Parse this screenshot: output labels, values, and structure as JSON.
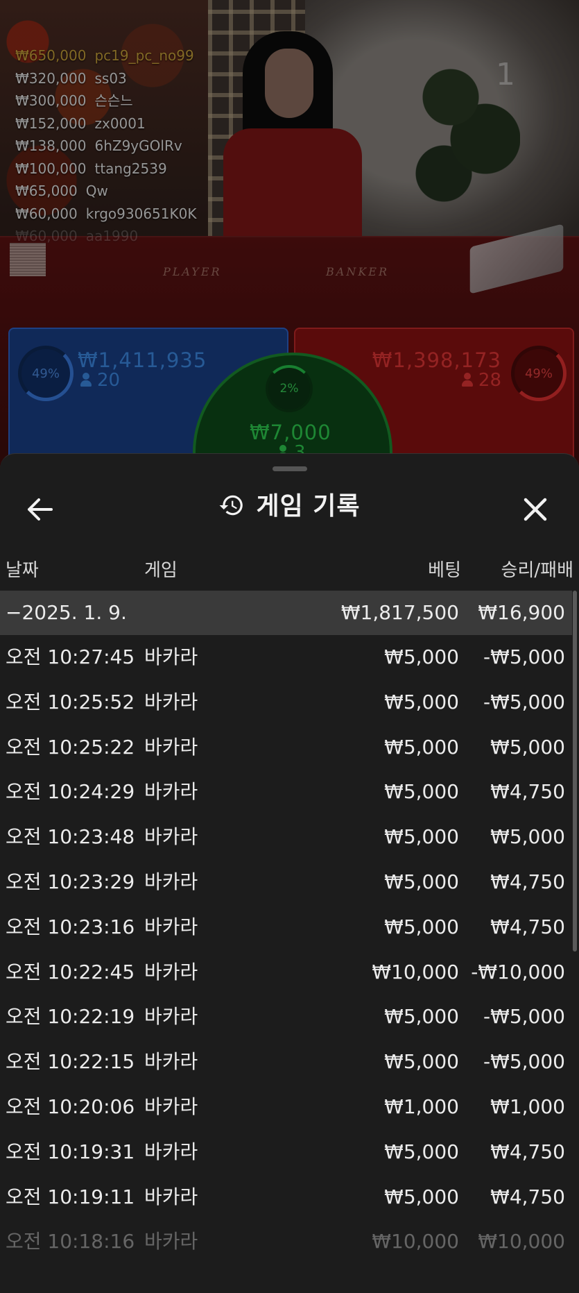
{
  "live": {
    "round_number": "1",
    "table_labels": {
      "player": "PLAYER",
      "banker": "BANKER"
    },
    "leaderboard": [
      {
        "amount": "₩650,000",
        "user": "pc19_pc_no99"
      },
      {
        "amount": "₩320,000",
        "user": "ss03"
      },
      {
        "amount": "₩300,000",
        "user": "슨슨느"
      },
      {
        "amount": "₩152,000",
        "user": "zx0001"
      },
      {
        "amount": "₩138,000",
        "user": "6hZ9yGOlRv"
      },
      {
        "amount": "₩100,000",
        "user": "ttang2539"
      },
      {
        "amount": "₩65,000",
        "user": "Qw"
      },
      {
        "amount": "₩60,000",
        "user": "krgo930651K0K"
      },
      {
        "amount": "₩60,000",
        "user": "aa1990"
      }
    ],
    "player": {
      "percent": "49%",
      "amount": "₩1,411,935",
      "count": "20"
    },
    "banker": {
      "percent": "49%",
      "amount": "₩1,398,173",
      "count": "28"
    },
    "tie": {
      "percent": "2%",
      "amount": "₩7,000",
      "count": "3"
    },
    "colors": {
      "player": "#3c8ae6",
      "banker": "#e33636",
      "tie": "#2ed050"
    }
  },
  "history": {
    "title": "게임 기록",
    "icons": {
      "back": "arrow-left-icon",
      "history": "history-icon",
      "close": "close-icon"
    },
    "columns": {
      "date": "날짜",
      "game": "게임",
      "bet": "베팅",
      "result": "승리/패배"
    },
    "date_group": {
      "label": "−2025. 1. 9.",
      "bet_total": "₩1,817,500",
      "result_total": "₩16,900"
    },
    "rows": [
      {
        "time": "오전 10:27:45",
        "game": "바카라",
        "bet": "₩5,000",
        "result": "-₩5,000"
      },
      {
        "time": "오전 10:25:52",
        "game": "바카라",
        "bet": "₩5,000",
        "result": "-₩5,000"
      },
      {
        "time": "오전 10:25:22",
        "game": "바카라",
        "bet": "₩5,000",
        "result": "₩5,000"
      },
      {
        "time": "오전 10:24:29",
        "game": "바카라",
        "bet": "₩5,000",
        "result": "₩4,750"
      },
      {
        "time": "오전 10:23:48",
        "game": "바카라",
        "bet": "₩5,000",
        "result": "₩5,000"
      },
      {
        "time": "오전 10:23:29",
        "game": "바카라",
        "bet": "₩5,000",
        "result": "₩4,750"
      },
      {
        "time": "오전 10:23:16",
        "game": "바카라",
        "bet": "₩5,000",
        "result": "₩4,750"
      },
      {
        "time": "오전 10:22:45",
        "game": "바카라",
        "bet": "₩10,000",
        "result": "-₩10,000"
      },
      {
        "time": "오전 10:22:19",
        "game": "바카라",
        "bet": "₩5,000",
        "result": "-₩5,000"
      },
      {
        "time": "오전 10:22:15",
        "game": "바카라",
        "bet": "₩5,000",
        "result": "-₩5,000"
      },
      {
        "time": "오전 10:20:06",
        "game": "바카라",
        "bet": "₩1,000",
        "result": "₩1,000"
      },
      {
        "time": "오전 10:19:31",
        "game": "바카라",
        "bet": "₩5,000",
        "result": "₩4,750"
      },
      {
        "time": "오전 10:19:11",
        "game": "바카라",
        "bet": "₩5,000",
        "result": "₩4,750"
      },
      {
        "time": "오전 10:18:16",
        "game": "바카라",
        "bet": "₩10,000",
        "result": "₩10,000"
      }
    ]
  }
}
